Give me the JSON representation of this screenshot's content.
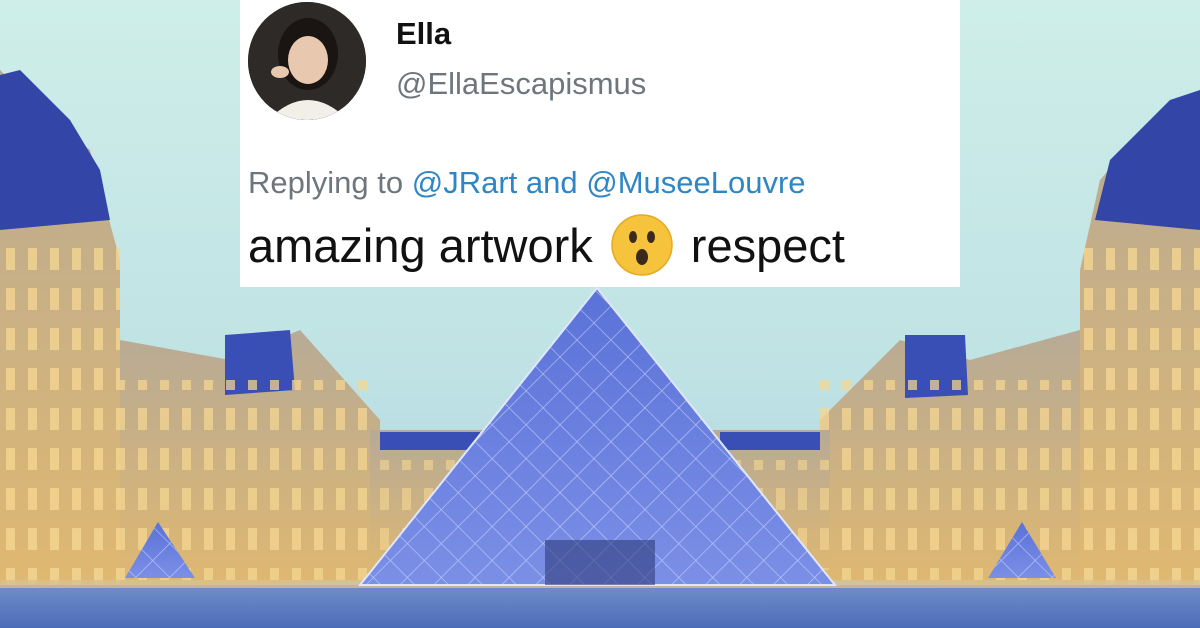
{
  "tweet": {
    "display_name": "Ella",
    "handle": "@EllaEscapismus",
    "replying_prefix": "Replying to ",
    "reply_mentions": [
      "@JRart",
      "@MuseeLouvre"
    ],
    "reply_joiner": " and ",
    "text_before_emoji": "amazing artwork",
    "emoji": "hushed-face-emoji",
    "text_after_emoji": "respect"
  },
  "background": {
    "subject": "louvre-pyramid-photo"
  },
  "colors": {
    "mention_blue": "#2f86c4",
    "muted_gray": "#6e767d",
    "text_dark": "#111111"
  }
}
